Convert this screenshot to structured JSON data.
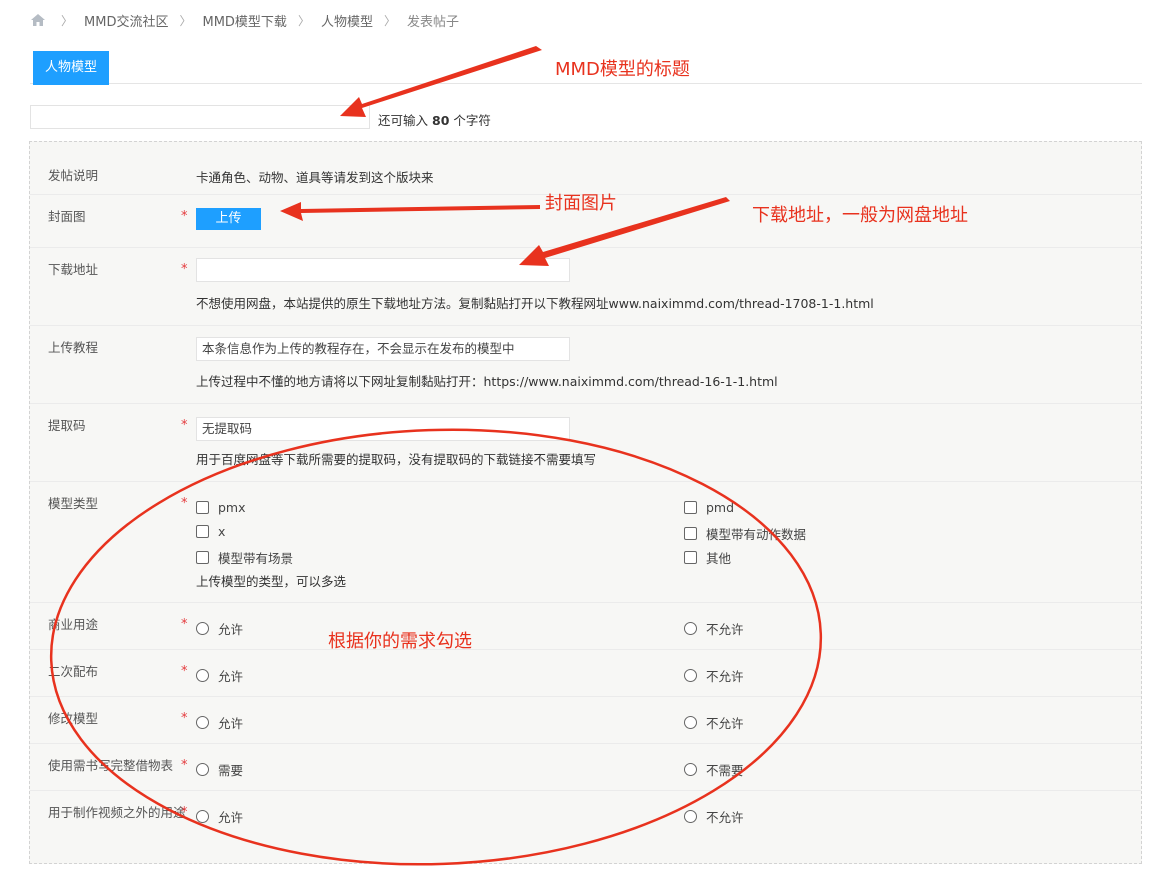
{
  "breadcrumb": {
    "items": [
      "MMD交流社区",
      "MMD模型下载",
      "人物模型"
    ],
    "current": "发表帖子"
  },
  "tab": {
    "label": "人物模型"
  },
  "title_field": {
    "value": "",
    "hint_prefix": "还可输入",
    "hint_count": "80",
    "hint_suffix": "个字符"
  },
  "form": {
    "desc": {
      "label": "发帖说明",
      "value": "卡通角色、动物、道具等请发到这个版块来"
    },
    "cover": {
      "label": "封面图",
      "button": "上传"
    },
    "download": {
      "label": "下载地址",
      "value": "",
      "help": "不想使用网盘，本站提供的原生下载地址方法。复制黏贴打开以下教程网址www.naiximmd.com/thread-1708-1-1.html"
    },
    "tutorial": {
      "label": "上传教程",
      "value": "本条信息作为上传的教程存在，不会显示在发布的模型中",
      "help": "上传过程中不懂的地方请将以下网址复制黏贴打开：https://www.naiximmd.com/thread-16-1-1.html"
    },
    "code": {
      "label": "提取码",
      "value": "无提取码",
      "help": "用于百度网盘等下载所需要的提取码，没有提取码的下载链接不需要填写"
    },
    "model_type": {
      "label": "模型类型",
      "options": [
        "pmx",
        "pmd",
        "x",
        "模型带有动作数据",
        "模型带有场景",
        "其他"
      ],
      "help": "上传模型的类型，可以多选"
    },
    "commercial": {
      "label": "商业用途",
      "options": [
        "允许",
        "不允许"
      ]
    },
    "redistribute": {
      "label": "二次配布",
      "options": [
        "允许",
        "不允许"
      ]
    },
    "modify": {
      "label": "修改模型",
      "options": [
        "允许",
        "不允许"
      ]
    },
    "credit": {
      "label": "使用需书写完整借物表",
      "options": [
        "需要",
        "不需要"
      ]
    },
    "non_video": {
      "label": "用于制作视频之外的用途",
      "options": [
        "允许",
        "不允许"
      ]
    }
  },
  "annotations": {
    "title_note": "MMD模型的标题",
    "cover_note": "封面图片",
    "download_note": "下载地址，一般为网盘地址",
    "choose_note": "根据你的需求勾选"
  },
  "colors": {
    "accent": "#1e9fff",
    "annotation": "#e8321e",
    "required": "#e4393c"
  }
}
